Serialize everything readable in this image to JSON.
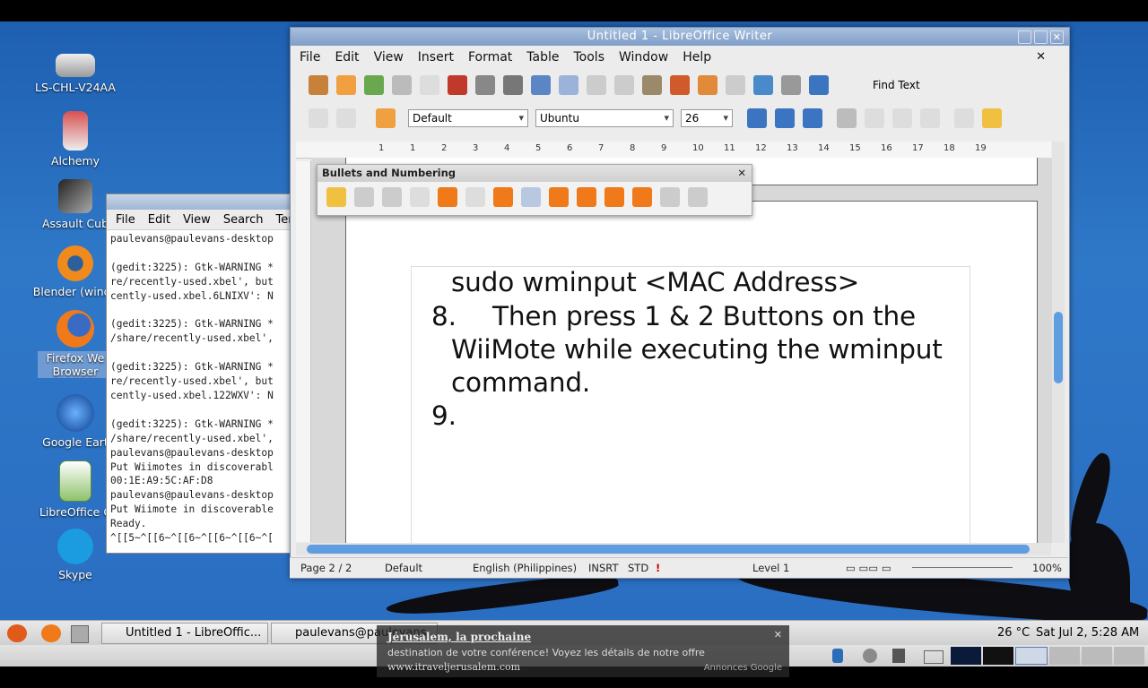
{
  "desktop": {
    "icons": [
      {
        "label": "LS-CHL-V24AA",
        "icon": "drive-icon"
      },
      {
        "label": "Alchemy",
        "icon": "alchemy-icon"
      },
      {
        "label": "Assault Cub",
        "icon": "assaultcube-icon"
      },
      {
        "label": "Blender (windo",
        "icon": "blender-icon"
      },
      {
        "label": "Firefox We\nBrowser",
        "icon": "firefox-icon"
      },
      {
        "label": "Google Eart",
        "icon": "google-earth-icon"
      },
      {
        "label": "LibreOffice C",
        "icon": "libreoffice-calc-icon"
      },
      {
        "label": "Skype",
        "icon": "skype-icon"
      }
    ]
  },
  "terminal": {
    "menu": [
      "File",
      "Edit",
      "View",
      "Search",
      "Ter"
    ],
    "lines": "paulevans@paulevans-desktop\n\n(gedit:3225): Gtk-WARNING *\nre/recently-used.xbel', but\ncently-used.xbel.6LNIXV': N\n\n(gedit:3225): Gtk-WARNING *\n/share/recently-used.xbel',\n\n(gedit:3225): Gtk-WARNING *\nre/recently-used.xbel', but\ncently-used.xbel.122WXV': N\n\n(gedit:3225): Gtk-WARNING *\n/share/recently-used.xbel',\npaulevans@paulevans-desktop\nPut Wiimotes in discoverabl\n00:1E:A9:5C:AF:D8\npaulevans@paulevans-desktop\nPut Wiimote in discoverable\nReady.\n^[[5~^[[6~^[[6~^[[6~^[[6~^["
  },
  "writer": {
    "title": "Untitled 1 - LibreOffice Writer",
    "menu": [
      "File",
      "Edit",
      "View",
      "Insert",
      "Format",
      "Table",
      "Tools",
      "Window",
      "Help"
    ],
    "find_text": "Find Text",
    "style": "Default",
    "font": "Ubuntu",
    "size": "26",
    "ruler_numbers": [
      "1",
      "1",
      "2",
      "3",
      "4",
      "5",
      "6",
      "7",
      "8",
      "9",
      "10",
      "11",
      "12",
      "13",
      "14",
      "15",
      "16",
      "17",
      "18",
      "19"
    ],
    "doc_lines": [
      "sudo wminput <MAC Address>",
      "8.",
      "Then press 1 & 2 Buttons on the",
      "WiiMote while executing the wminput",
      "command.",
      "9."
    ],
    "status": {
      "page": "Page 2 / 2",
      "style": "Default",
      "language": "English (Philippines)",
      "insert": "INSRT",
      "std": "STD",
      "level": "Level 1",
      "zoom": "100%"
    }
  },
  "bullets_panel": {
    "title": "Bullets and Numbering"
  },
  "panel": {
    "tasks": [
      "Untitled 1 - LibreOffic...",
      "paulevans@paulevans..."
    ],
    "weather": "26 °C",
    "clock": "Sat Jul 2, 5:28 AM"
  },
  "ad": {
    "title": "Jérusalem, la prochaine",
    "text": "destination de votre conférence! Voyez les détails de notre offre",
    "url": "www.itraveljerusalem.com",
    "source": "Annonces Google"
  },
  "colors": {
    "desktop": "#2a6ec2",
    "title": "#7f9dc8",
    "accent_orange": "#f07a1a"
  }
}
